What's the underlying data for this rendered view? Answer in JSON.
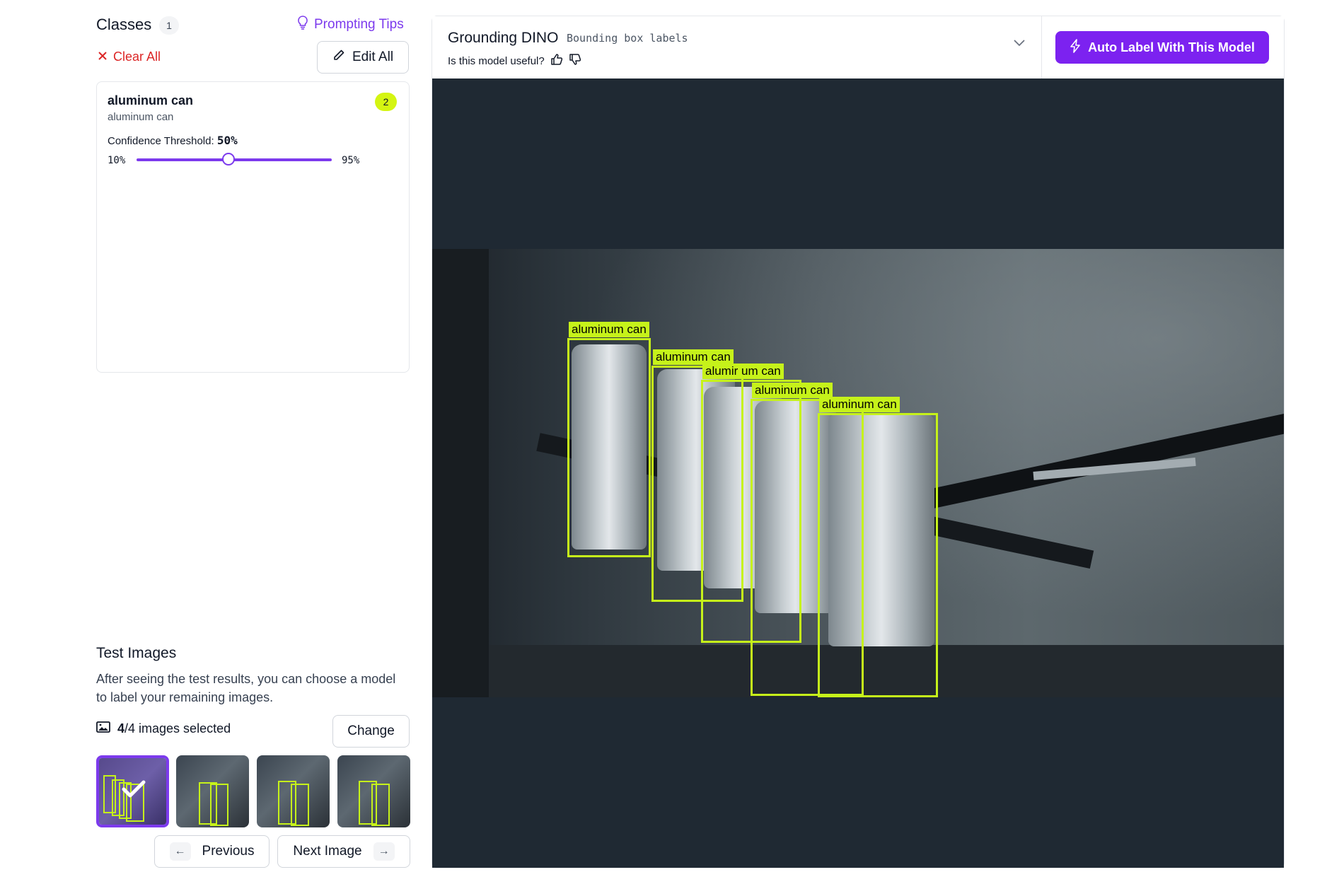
{
  "classes": {
    "title": "Classes",
    "count": "1",
    "prompting_tips": "Prompting Tips",
    "clear_all": "Clear All",
    "edit_all": "Edit All",
    "items": [
      {
        "name": "aluminum can",
        "description": "aluminum can",
        "count": "2",
        "confidence_label": "Confidence Threshold:",
        "confidence_value": "50%",
        "slider_min": "10%",
        "slider_max": "95%",
        "slider_fraction": 0.47
      }
    ]
  },
  "test_images": {
    "title": "Test Images",
    "description": "After seeing the test results, you can choose a model to label your remaining images.",
    "selected_count": "4",
    "selected_total": "/4 images selected",
    "change": "Change",
    "previous": "Previous",
    "next": "Next Image"
  },
  "model": {
    "name": "Grounding DINO",
    "type": "Bounding box labels",
    "useful_question": "Is this model useful?",
    "auto_label": "Auto Label With This Model"
  },
  "detections": {
    "labels": [
      "aluminum can",
      "aluminum can",
      "alumir um can",
      "aluminum can",
      "aluminum can"
    ]
  },
  "colors": {
    "accent": "#7c3aed",
    "primary_button": "#7c22f0",
    "bbox": "#c6f21a",
    "danger": "#dc2626",
    "viewer_bg": "#1f2933"
  },
  "icons": [
    "bulb-icon",
    "close-icon",
    "pencil-icon",
    "thumbs-up-icon",
    "thumbs-down-icon",
    "chevron-down-icon",
    "lightning-icon",
    "image-icon",
    "check-icon",
    "arrow-left-icon",
    "arrow-right-icon"
  ]
}
